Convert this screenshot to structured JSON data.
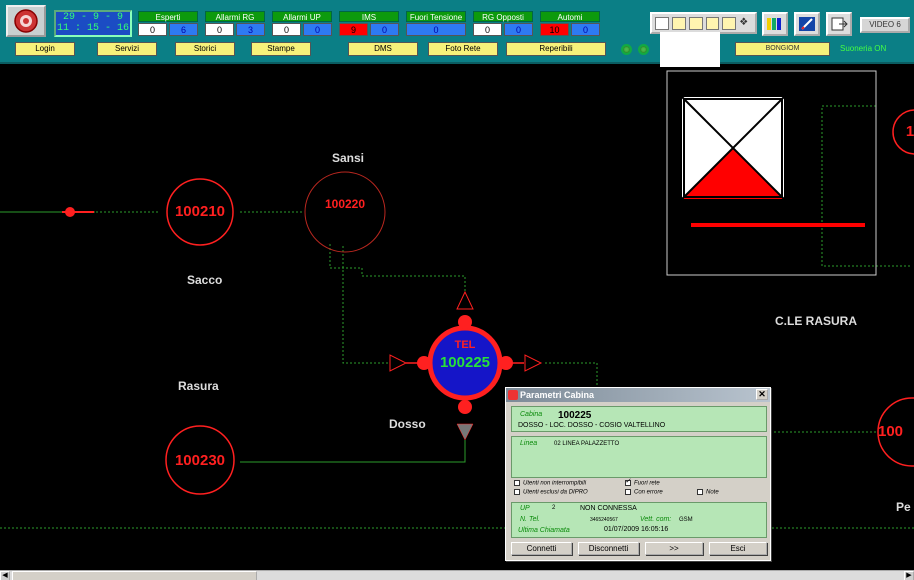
{
  "clock": {
    "date": "29 - 9 - 9",
    "time": "11 : 15 - 16"
  },
  "counters": [
    {
      "title": "Esperti",
      "values": [
        "0",
        "6"
      ]
    },
    {
      "title": "Allarmi RG",
      "values": [
        "0",
        "3"
      ]
    },
    {
      "title": "Allarmi UP",
      "values": [
        "0",
        "0"
      ]
    },
    {
      "title": "IMS",
      "values": [
        "9",
        "0"
      ]
    },
    {
      "title": "Fuori Tensione",
      "values": [
        "0"
      ]
    },
    {
      "title": "RG Opposti",
      "values": [
        "0",
        "0"
      ]
    },
    {
      "title": "Automi",
      "values": [
        "10",
        "0"
      ]
    }
  ],
  "nav": [
    "Login",
    "Servizi",
    "Storici",
    "Stampe",
    "DMS",
    "Foto Rete",
    "Reperibili"
  ],
  "operator": "BONGIOM",
  "suoneria": "Suoneria ON",
  "video": "VIDEO 6",
  "map": {
    "labels": {
      "sansi": "Sansi",
      "sacco": "Sacco",
      "rasura": "Rasura",
      "dosso": "Dosso",
      "rasura_station": "C.LE RASURA",
      "pe": "Pe"
    },
    "nodes": {
      "n210": "100210",
      "n220": "100220",
      "n230": "100230",
      "n225": "100225",
      "tel": "TEL",
      "edge_right_top": "1",
      "edge_right_mid": "100"
    }
  },
  "dialog": {
    "title": "Parametri Cabina",
    "cabina_label": "Cabina",
    "cabina_id": "100225",
    "cabina_desc": "DOSSO - LOC. DOSSO - COSIO VALTELLINO",
    "linea_label": "Linea",
    "linea_value": "02 LINEA PALAZZETTO",
    "opt_utenti_non_interrompibili": "Utenti non interrompibili",
    "opt_fuori_rete": "Fuori rete",
    "opt_utenti_esclusi": "Utenti esclusi da DIPRO",
    "opt_con_errore": "Con errore",
    "opt_note": "Note",
    "up_label": "UP",
    "up_value": "2",
    "up_status": "NON CONNESSA",
    "ntel_label": "N. Tel.",
    "ntel_value": "3465240567",
    "vett_label": "Vett. com:",
    "vett_value": "GSM",
    "ultima_label": "Ultima Chiamata",
    "ultima_value": "01/07/2009 16:05:16",
    "btn_connetti": "Connetti",
    "btn_disconnetti": "Disconnetti",
    "btn_next": ">>",
    "btn_esci": "Esci"
  },
  "colors": {
    "toolbar": "#0b7f86",
    "node": "#ff2020",
    "dialog_panel": "#b6e6b6",
    "line": "#2c9c2c"
  }
}
